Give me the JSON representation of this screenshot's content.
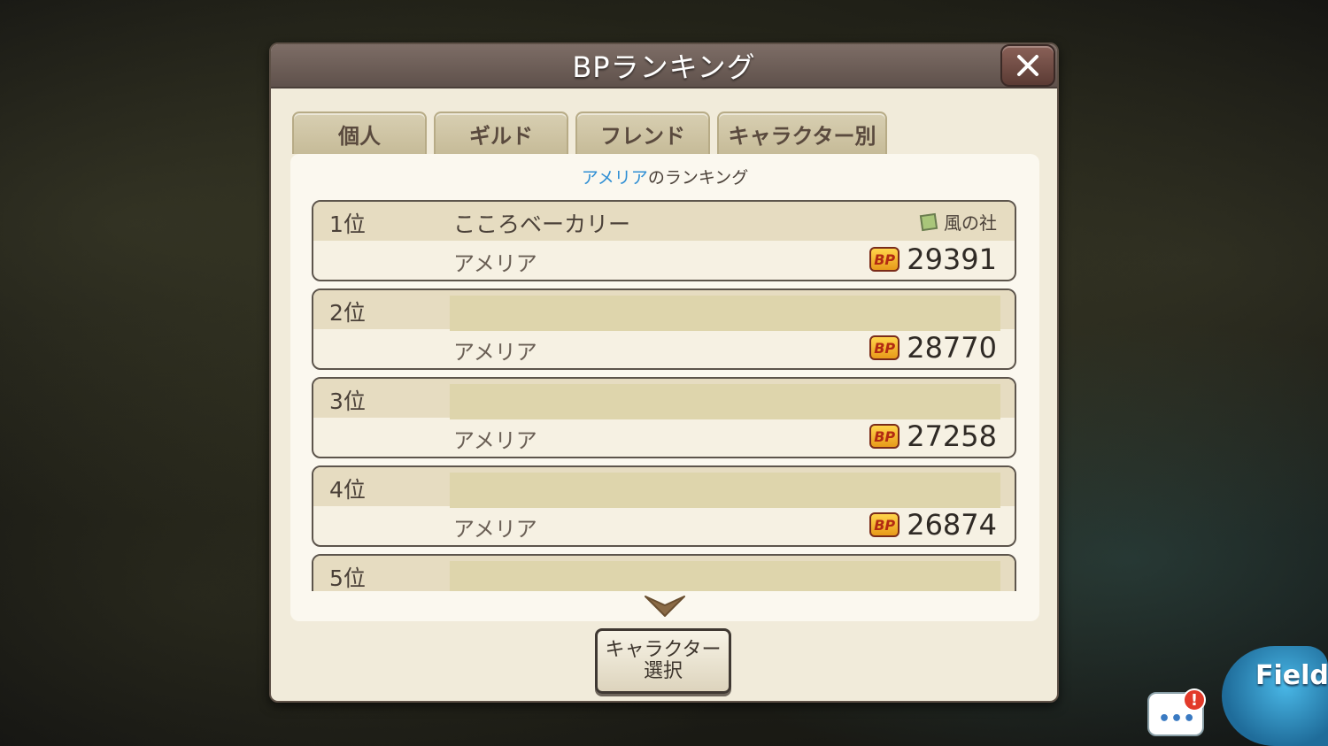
{
  "dialog": {
    "title": "BPランキング",
    "close_label": "✕"
  },
  "tabs": [
    {
      "label": "個人"
    },
    {
      "label": "ギルド"
    },
    {
      "label": "フレンド"
    },
    {
      "label": "キャラクター別"
    }
  ],
  "ranking": {
    "heading_name": "アメリア",
    "heading_suffix": "のランキング",
    "rows": [
      {
        "rank": "1位",
        "player": "こころベーカリー",
        "guild": "風の社",
        "character": "アメリア",
        "bp": "29391"
      },
      {
        "rank": "2位",
        "player": "",
        "guild": "",
        "character": "アメリア",
        "bp": "28770"
      },
      {
        "rank": "3位",
        "player": "",
        "guild": "",
        "character": "アメリア",
        "bp": "27258"
      },
      {
        "rank": "4位",
        "player": "",
        "guild": "",
        "character": "アメリア",
        "bp": "26874"
      },
      {
        "rank": "5位",
        "player": "",
        "guild": "",
        "character": "",
        "bp": ""
      }
    ]
  },
  "select_button": {
    "line1": "キャラクター",
    "line2": "選択"
  },
  "hud": {
    "chat_alert": "!",
    "field_label": "Field"
  },
  "icons": {
    "bp_icon_text": "BP"
  }
}
